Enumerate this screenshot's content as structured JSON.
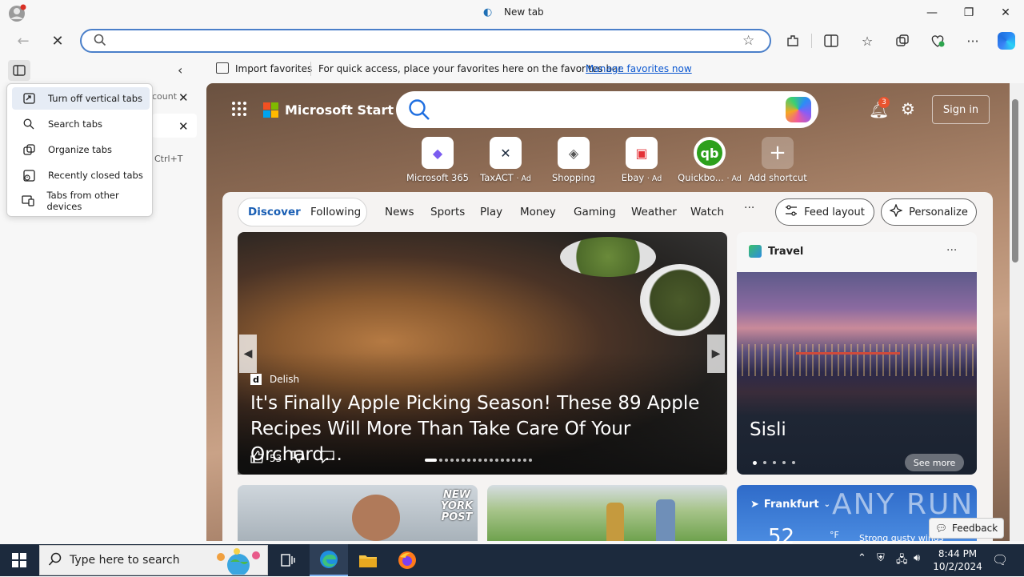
{
  "window": {
    "title": "New tab",
    "controls": {
      "minimize": "—",
      "restore": "❐",
      "close": "✕"
    }
  },
  "nav": {
    "address_value": "",
    "address_placeholder": ""
  },
  "favorites_bar": {
    "import_label": "Import favorites",
    "hint": "For quick access, place your favorites here on the favorites bar.",
    "manage_link": "Manage favorites now"
  },
  "side_panel": {
    "tab_title_partial": "count",
    "new_tab_shortcut": "Ctrl+T",
    "menu": [
      {
        "label": "Turn off vertical tabs",
        "icon": "vertical-tabs-icon",
        "selected": true
      },
      {
        "label": "Search tabs",
        "icon": "search-icon"
      },
      {
        "label": "Organize tabs",
        "icon": "organize-tabs-icon"
      },
      {
        "label": "Recently closed tabs",
        "icon": "recently-closed-icon"
      },
      {
        "label": "Tabs from other devices",
        "icon": "devices-icon"
      }
    ]
  },
  "ntp": {
    "brand": "Microsoft Start",
    "notification_count": "3",
    "sign_in": "Sign in",
    "shortcuts": [
      {
        "label": "Microsoft 365",
        "tile": "◆",
        "color": "#7b5cf0"
      },
      {
        "label": "TaxACT",
        "ad": "· Ad",
        "tile": "✕",
        "color": "#1c2a3d"
      },
      {
        "label": "Shopping",
        "tile": "◈",
        "color": "#555555"
      },
      {
        "label": "Ebay",
        "ad": "· Ad",
        "tile": "▣",
        "color": "#e43137"
      },
      {
        "label": "Quickbo...",
        "ad": "· Ad",
        "tile": "qb",
        "color": "#2ca01c"
      },
      {
        "label": "Add shortcut",
        "tile": "+",
        "color": "#ffffff"
      }
    ],
    "feed_tabs": {
      "primary": [
        "Discover",
        "Following"
      ],
      "secondary": [
        "News",
        "Sports",
        "Play",
        "Money",
        "Gaming",
        "Weather",
        "Watch"
      ],
      "more": "···"
    },
    "feed_layout": "Feed layout",
    "personalize": "Personalize",
    "hero": {
      "source": "Delish",
      "source_logo": "d",
      "title": "It's Finally Apple Picking Season! These 89 Apple Recipes Will More Than Take Care Of Your Orchard…",
      "likes": "53"
    },
    "travel": {
      "heading": "Travel",
      "city": "Sisli",
      "see_more": "See more"
    },
    "card_a_stamp": "NEW YORK POST",
    "weather": {
      "location": "Frankfurt",
      "temp": "52",
      "unit": "°F",
      "condition": "Strong gusty winds"
    },
    "watermark": "ANY RUN",
    "feedback": "Feedback"
  },
  "taskbar": {
    "search_placeholder": "Type here to search",
    "time": "8:44 PM",
    "date": "10/2/2024"
  }
}
